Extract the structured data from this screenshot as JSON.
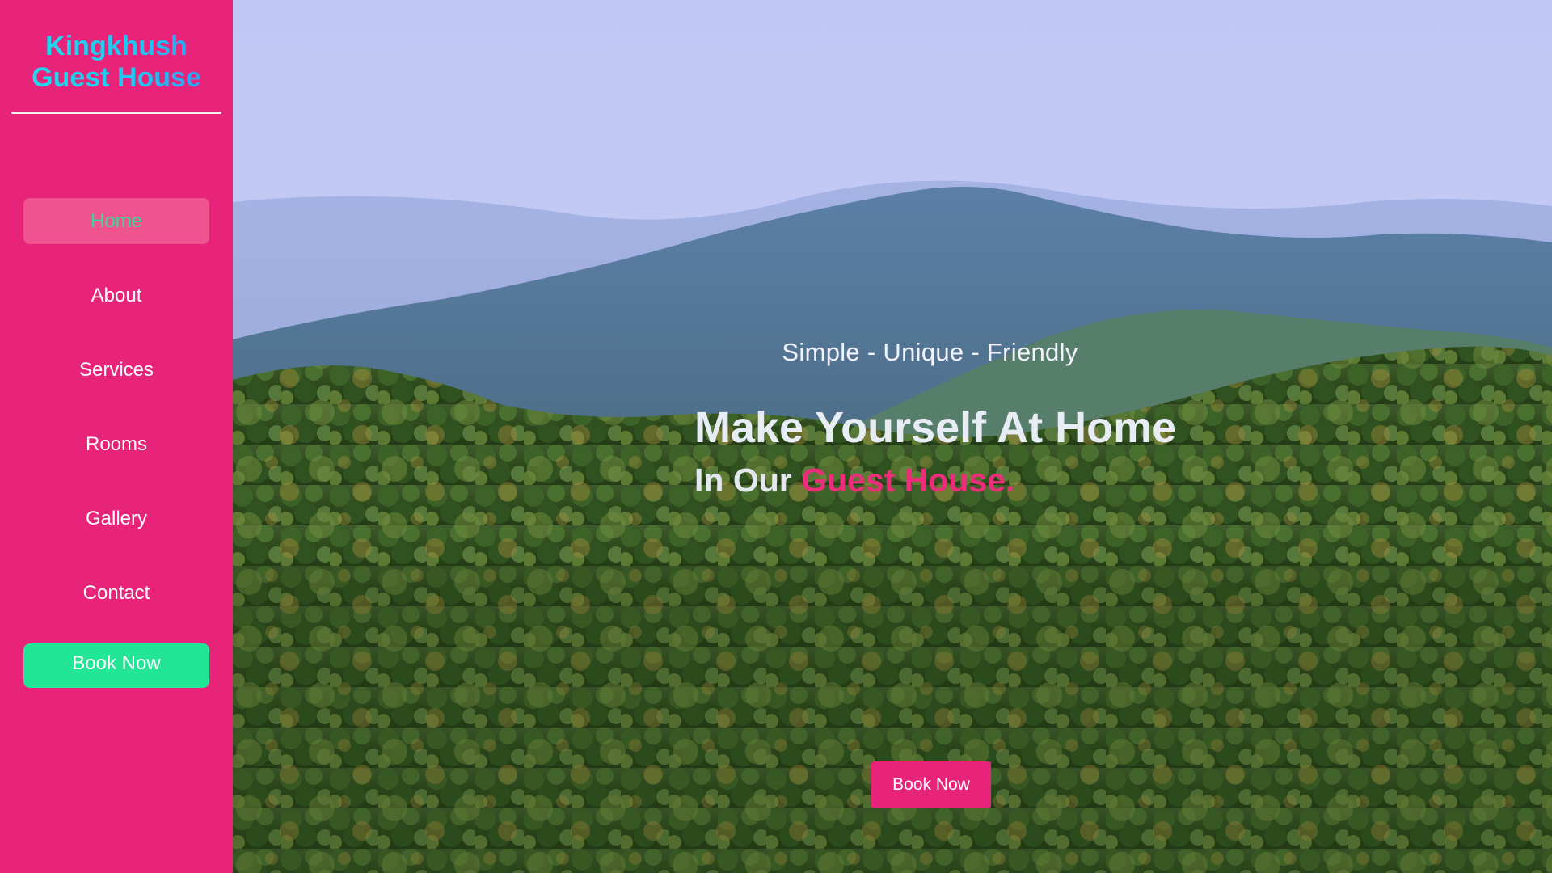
{
  "brand": {
    "line1": "Kingkhush",
    "line2": "Guest House"
  },
  "nav": {
    "items": [
      {
        "label": "Home",
        "active": true
      },
      {
        "label": "About",
        "active": false
      },
      {
        "label": "Services",
        "active": false
      },
      {
        "label": "Rooms",
        "active": false
      },
      {
        "label": "Gallery",
        "active": false
      },
      {
        "label": "Contact",
        "active": false
      }
    ],
    "book_label": "Book Now"
  },
  "hero": {
    "tagline": "Simple - Unique - Friendly",
    "headline": "Make Yourself At Home",
    "subline_prefix": "In Our ",
    "subline_accent": "Guest House.",
    "book_label": "Book Now"
  },
  "colors": {
    "sidebar": "#e8237a",
    "active_nav_bg": "#f0548f",
    "active_nav_text": "#38d996",
    "book_green": "#22e595",
    "accent_pink": "#ec2d79"
  }
}
